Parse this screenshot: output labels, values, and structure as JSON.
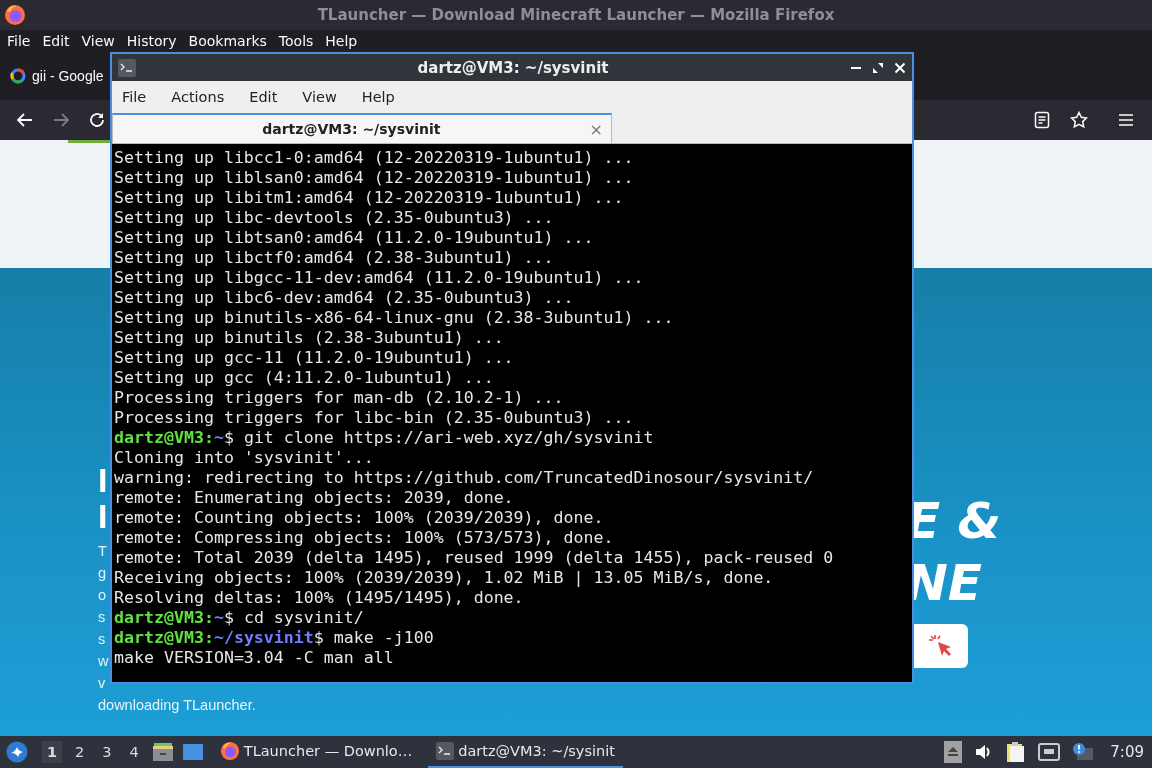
{
  "browser": {
    "title": "TLauncher — Download Minecraft Launcher — Mozilla Firefox",
    "menu": [
      "File",
      "Edit",
      "View",
      "History",
      "Bookmarks",
      "Tools",
      "Help"
    ],
    "tab": {
      "label": "gii - Google"
    },
    "nav": {
      "back_disabled": false,
      "forward_disabled": true
    },
    "page": {
      "heading_left": [
        "I",
        "I"
      ],
      "text_left": [
        "T",
        "g",
        "o",
        "s",
        "s",
        "w",
        "v",
        "downloading TLauncher."
      ],
      "heading_right": [
        "E &",
        "NE"
      ]
    }
  },
  "terminal": {
    "title": "dartz@VM3: ~/sysvinit",
    "menu": [
      "File",
      "Actions",
      "Edit",
      "View",
      "Help"
    ],
    "tabs": [
      {
        "label": "dartz@VM3: ~/sysvinit",
        "selected": true,
        "close": "×"
      }
    ],
    "lines": [
      {
        "kind": "output",
        "text": "Setting up libcc1-0:amd64 (12-20220319-1ubuntu1) ..."
      },
      {
        "kind": "output",
        "text": "Setting up liblsan0:amd64 (12-20220319-1ubuntu1) ..."
      },
      {
        "kind": "output",
        "text": "Setting up libitm1:amd64 (12-20220319-1ubuntu1) ..."
      },
      {
        "kind": "output",
        "text": "Setting up libc-devtools (2.35-0ubuntu3) ..."
      },
      {
        "kind": "output",
        "text": "Setting up libtsan0:amd64 (11.2.0-19ubuntu1) ..."
      },
      {
        "kind": "output",
        "text": "Setting up libctf0:amd64 (2.38-3ubuntu1) ..."
      },
      {
        "kind": "output",
        "text": "Setting up libgcc-11-dev:amd64 (11.2.0-19ubuntu1) ..."
      },
      {
        "kind": "output",
        "text": "Setting up libc6-dev:amd64 (2.35-0ubuntu3) ..."
      },
      {
        "kind": "output",
        "text": "Setting up binutils-x86-64-linux-gnu (2.38-3ubuntu1) ..."
      },
      {
        "kind": "output",
        "text": "Setting up binutils (2.38-3ubuntu1) ..."
      },
      {
        "kind": "output",
        "text": "Setting up gcc-11 (11.2.0-19ubuntu1) ..."
      },
      {
        "kind": "output",
        "text": "Setting up gcc (4:11.2.0-1ubuntu1) ..."
      },
      {
        "kind": "output",
        "text": "Processing triggers for man-db (2.10.2-1) ..."
      },
      {
        "kind": "output",
        "text": "Processing triggers for libc-bin (2.35-0ubuntu3) ..."
      },
      {
        "kind": "prompt",
        "user": "dartz@VM3:",
        "path": "~",
        "command": "$ git clone https://ari-web.xyz/gh/sysvinit"
      },
      {
        "kind": "output",
        "text": "Cloning into 'sysvinit'..."
      },
      {
        "kind": "output",
        "text": "warning: redirecting to https://github.com/TruncatedDinosour/sysvinit/"
      },
      {
        "kind": "output",
        "text": "remote: Enumerating objects: 2039, done."
      },
      {
        "kind": "output",
        "text": "remote: Counting objects: 100% (2039/2039), done."
      },
      {
        "kind": "output",
        "text": "remote: Compressing objects: 100% (573/573), done."
      },
      {
        "kind": "output",
        "text": "remote: Total 2039 (delta 1495), reused 1999 (delta 1455), pack-reused 0"
      },
      {
        "kind": "output",
        "text": "Receiving objects: 100% (2039/2039), 1.02 MiB | 13.05 MiB/s, done."
      },
      {
        "kind": "output",
        "text": "Resolving deltas: 100% (1495/1495), done."
      },
      {
        "kind": "prompt",
        "user": "dartz@VM3:",
        "path": "~",
        "command": "$ cd sysvinit/"
      },
      {
        "kind": "prompt",
        "user": "dartz@VM3:",
        "path": "~/sysvinit",
        "command": "$ make -j100"
      },
      {
        "kind": "output",
        "text": "make VERSION=3.04 -C man all"
      }
    ]
  },
  "taskbar": {
    "workspaces": [
      {
        "label": "1",
        "selected": true
      },
      {
        "label": "2",
        "selected": false
      },
      {
        "label": "3",
        "selected": false
      },
      {
        "label": "4",
        "selected": false
      }
    ],
    "tasks": [
      {
        "label": "TLauncher — Downlo…",
        "kind": "browser",
        "selected": false
      },
      {
        "label": "dartz@VM3: ~/sysinit",
        "kind": "terminal",
        "selected": true
      }
    ],
    "clock": "7:09"
  }
}
